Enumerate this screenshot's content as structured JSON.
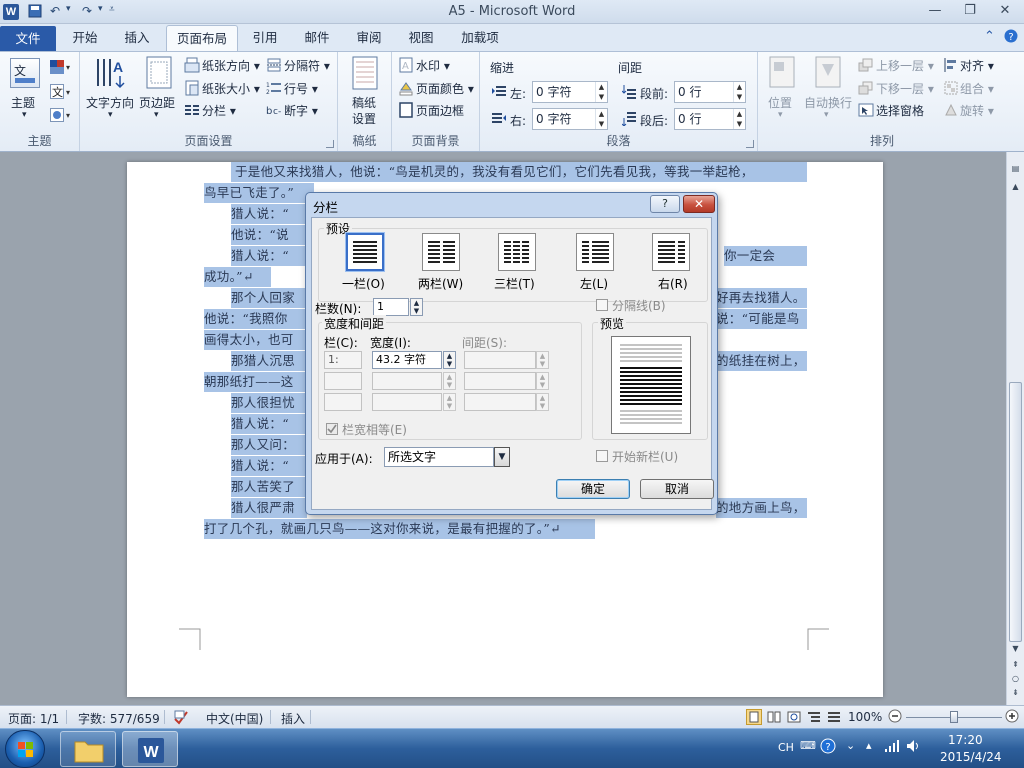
{
  "window": {
    "app_logo": "W",
    "title": "A5 - Microsoft Word",
    "qat": {
      "save_icon": "save-icon",
      "undo_icon": "undo-icon",
      "redo_icon": "redo-icon",
      "customize_icon": "customize-icon"
    },
    "controls": {
      "minimize": "—",
      "maximize": "❐",
      "close": "✕"
    }
  },
  "tabs": [
    "文件",
    "开始",
    "插入",
    "页面布局",
    "引用",
    "邮件",
    "审阅",
    "视图",
    "加载项"
  ],
  "active_tab": "页面布局",
  "ribbon": {
    "theme": {
      "label": "主题",
      "btn": "主题"
    },
    "page_setup": {
      "label": "页面设置",
      "text_direction": "文字方向",
      "margins": "页边距",
      "orientation": "纸张方向",
      "size": "纸张大小",
      "columns": "分栏",
      "breaks": "分隔符",
      "line_numbers": "行号",
      "hyphenation": "断字"
    },
    "paper": {
      "label": "稿纸",
      "btn_line1": "稿纸",
      "btn_line2": "设置"
    },
    "background": {
      "label": "页面背景",
      "watermark": "水印",
      "page_color": "页面颜色",
      "page_borders": "页面边框"
    },
    "paragraph": {
      "label": "段落",
      "indent": "缩进",
      "spacing": "间距",
      "left": "左:",
      "right": "右:",
      "left_val": "0 字符",
      "right_val": "0 字符",
      "before": "段前:",
      "after": "段后:",
      "before_val": "0 行",
      "after_val": "0 行"
    },
    "arrange": {
      "label": "排列",
      "position": "位置",
      "wrap": "自动换行",
      "bring_forward": "上移一层",
      "send_backward": "下移一层",
      "selection_pane": "选择窗格",
      "align": "对齐",
      "group": "组合",
      "rotate": "旋转"
    }
  },
  "document": {
    "lines": [
      "于是他又来找猎人，他说：“鸟是机灵的，我没有看见它们，它们先看见我，等我一举起枪，",
      "鸟早已飞走了。”",
      "猎人说：“",
      "他说：“说",
      "猎人说：“",
      "你一定会",
      "成功。”↵",
      "那个人回家",
      "好再去找猎人。",
      "他说：“我照你",
      "说：“可能是鸟",
      "画得太小，也可",
      "那猎人沉思",
      "的纸挂在树上，",
      "朝那纸打——这",
      "那人很担忧",
      "猎人说：“",
      "那人又问：",
      "猎人说：“",
      "那人苦笑了",
      "猎人很严肃",
      "的地方画上鸟，",
      "打了几个孔，就画几只鸟——这对你来说，是最有把握的了。”↵"
    ]
  },
  "dialog": {
    "title": "分栏",
    "help": "?",
    "close": "✕",
    "presets_label": "预设",
    "presets": [
      "一栏(O)",
      "两栏(W)",
      "三栏(T)",
      "左(L)",
      "右(R)"
    ],
    "num_cols_label": "栏数(N):",
    "num_cols_value": "1",
    "line_between": "分隔线(B)",
    "width_spacing_label": "宽度和间距",
    "col_header": "栏(C):",
    "width_header": "宽度(I):",
    "spacing_header": "间距(S):",
    "col1_index": "1:",
    "col1_width": "43.2 字符",
    "equal_width": "栏宽相等(E)",
    "preview_label": "预览",
    "apply_label": "应用于(A):",
    "apply_value": "所选文字",
    "new_column": "开始新栏(U)",
    "ok": "确定",
    "cancel": "取消"
  },
  "status": {
    "page": "页面: 1/1",
    "words": "字数: 577/659",
    "language": "中文(中国)",
    "mode": "插入",
    "zoom": "100%",
    "zoom_level": 1.0
  },
  "taskbar": {
    "ime": "CH",
    "time": "17:20",
    "date": "2015/4/24"
  }
}
